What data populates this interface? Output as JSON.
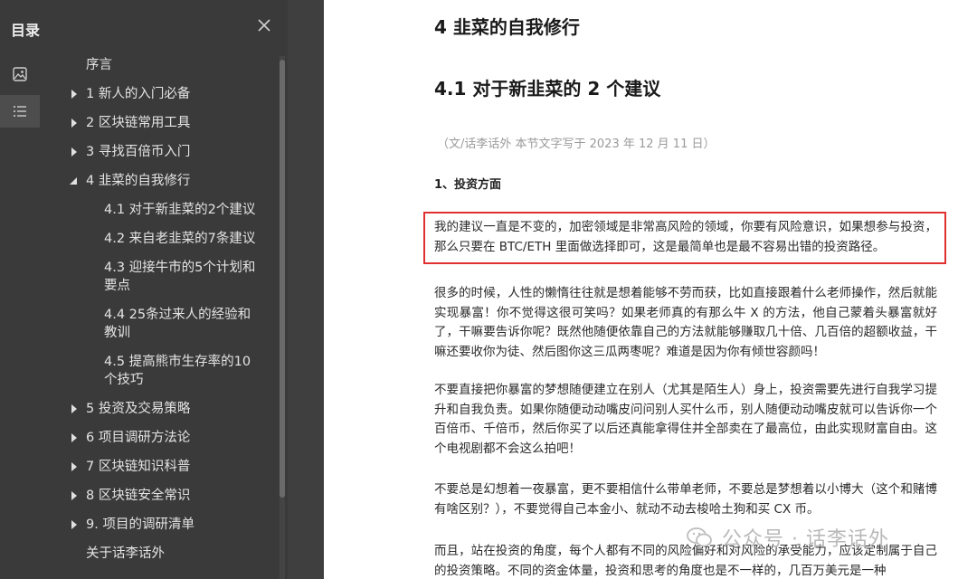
{
  "sidebar": {
    "title": "目录",
    "toc": [
      {
        "label": "序言",
        "expandable": false
      },
      {
        "label": "1 新人的入门必备",
        "expandable": true,
        "expanded": false
      },
      {
        "label": "2 区块链常用工具",
        "expandable": true,
        "expanded": false
      },
      {
        "label": "3 寻找百倍币入门",
        "expandable": true,
        "expanded": false
      },
      {
        "label": "4 韭菜的自我修行",
        "expandable": true,
        "expanded": true
      },
      {
        "label": "5 投资及交易策略",
        "expandable": true,
        "expanded": false
      },
      {
        "label": "6 项目调研方法论",
        "expandable": true,
        "expanded": false
      },
      {
        "label": "7 区块链知识科普",
        "expandable": true,
        "expanded": false
      },
      {
        "label": "8 区块链安全常识",
        "expandable": true,
        "expanded": false
      },
      {
        "label": "9. 项目的调研清单",
        "expandable": true,
        "expanded": false
      },
      {
        "label": "关于话李话外",
        "expandable": false
      }
    ],
    "subitems": [
      {
        "label": "4.1 对于新韭菜的2个建议"
      },
      {
        "label": "4.2 来自老韭菜的7条建议"
      },
      {
        "label": "4.3 迎接牛市的5个计划和要点"
      },
      {
        "label": "4.4 25条过来人的经验和教训"
      },
      {
        "label": "4.5 提高熊市生存率的10个技巧"
      }
    ]
  },
  "document": {
    "chapter_title": "4 韭菜的自我修行",
    "section_title": "4.1 对于新韭菜的 2 个建议",
    "byline": "（文/话李话外 本节文字写于 2023 年 12 月 11 日）",
    "subsection": "1、投资方面",
    "paragraphs": [
      "我的建议一直是不变的，加密领域是非常高风险的领域，你要有风险意识，如果想参与投资，那么只要在 BTC/ETH 里面做选择即可，这是最简单也是最不容易出错的投资路径。",
      "很多的时候，人性的懒惰往往就是想着能够不劳而获，比如直接跟着什么老师操作，然后就能实现暴富！你不觉得这很可笑吗？如果老师真的有那么牛 X 的方法，他自己蒙着头暴富就好了，干嘛要告诉你呢？既然他随便依靠自己的方法就能够赚取几十倍、几百倍的超额收益，干嘛还要收你为徒、然后图你这三瓜两枣呢？难道是因为你有倾世容颜吗！",
      "不要直接把你暴富的梦想随便建立在别人（尤其是陌生人）身上，投资需要先进行自我学习提升和自我负责。如果你随便动动嘴皮问问别人买什么币，别人随便动动嘴皮就可以告诉你一个百倍币、千倍币，然后你买了以后还真能拿得住并全部卖在了最高位，由此实现财富自由。这个电视剧都不会这么拍吧！",
      "不要总是幻想着一夜暴富，更不要相信什么带单老师，不要总是梦想着以小博大（这个和赌博有啥区别？），不要觉得自己本金小、就动不动去梭哈土狗和买 CX 币。",
      "而且，站在投资的角度，每个人都有不同的风险偏好和对风险的承受能力，应该定制属于自己的投资策略。不同的资金体量，投资和思考的角度也是不一样的，几百万美元是一种"
    ],
    "watermark": "公众号 · 话李话外"
  },
  "colors": {
    "sidebar_bg": "#3a3a3a",
    "page_bg": "#ffffff",
    "highlight_border": "#e03030"
  }
}
